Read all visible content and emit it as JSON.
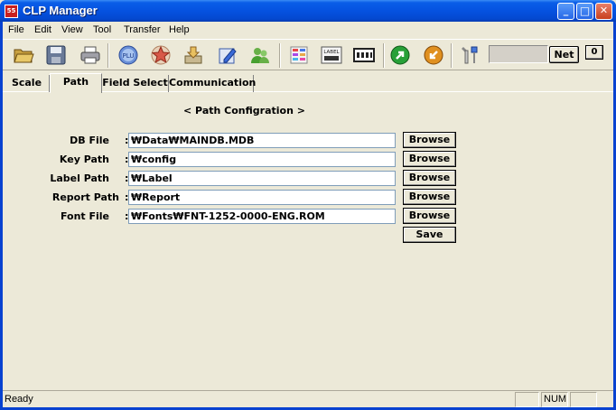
{
  "window": {
    "title": "CLP Manager",
    "app_icon_text": "55"
  },
  "titlebar_buttons": {
    "minimize": "_",
    "maximize": "□",
    "close": "✕"
  },
  "menu": [
    "File",
    "Edit",
    "View",
    "Tool",
    "Transfer",
    "Help"
  ],
  "toolbar": {
    "icons": [
      "open-folder-icon",
      "save-icon",
      "print-icon",
      "plu-icon",
      "star-icon",
      "download-icon",
      "edit-icon",
      "users-icon",
      "color-list-icon",
      "label-icon",
      "film-icon",
      "green-arrow-icon",
      "orange-arrow-icon",
      "tools-icon"
    ],
    "net_label": "Net",
    "zero_label": "0"
  },
  "tabs": [
    {
      "label": "Scale",
      "active": false
    },
    {
      "label": "Path",
      "active": true
    },
    {
      "label": "Field Select",
      "active": false
    },
    {
      "label": "Communication",
      "active": false
    }
  ],
  "form": {
    "title": "< Path Configration >",
    "rows": [
      {
        "label": "DB File",
        "value": "₩Data₩MAINDB.MDB",
        "button": "Browse"
      },
      {
        "label": "Key Path",
        "value": "₩config",
        "button": "Browse"
      },
      {
        "label": "Label Path",
        "value": "₩Label",
        "button": "Browse"
      },
      {
        "label": "Report Path",
        "value": "₩Report",
        "button": "Browse"
      },
      {
        "label": "Font File",
        "value": "₩Fonts₩FNT-1252-0000-ENG.ROM",
        "button": "Browse"
      }
    ],
    "save_label": "Save"
  },
  "statusbar": {
    "text": "Ready",
    "num": "NUM"
  },
  "colors": {
    "titlebar": "#0552e0",
    "face": "#ece9d8",
    "input_border": "#7f9db9"
  }
}
